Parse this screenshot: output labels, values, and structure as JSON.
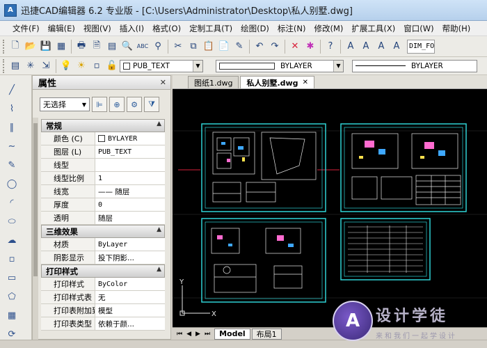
{
  "window": {
    "app_icon": "A",
    "title": "迅捷CAD编辑器 6.2 专业版  - [C:\\Users\\Administrator\\Desktop\\私人别墅.dwg]"
  },
  "menu": [
    "文件(F)",
    "编辑(E)",
    "视图(V)",
    "插入(I)",
    "格式(O)",
    "定制工具(T)",
    "绘图(D)",
    "标注(N)",
    "修改(M)",
    "扩展工具(X)",
    "窗口(W)",
    "帮助(H)"
  ],
  "toolbar1": {
    "icons": [
      "new-file-icon",
      "open-file-icon",
      "save-icon",
      "save-all-icon",
      "print-icon",
      "print-preview-icon",
      "plot-icon",
      "find-icon",
      "spell-check-icon",
      "binoculars-icon",
      "cut-icon",
      "copy-icon",
      "paste-icon",
      "paste-special-icon",
      "match-prop-icon",
      "undo-icon",
      "redo-icon",
      "delete-icon",
      "explode-icon",
      "help-icon",
      "text-a-icon",
      "text-a2-icon",
      "text-edit-icon",
      "text-style-icon"
    ],
    "glyphs": [
      "🗋",
      "📂",
      "💾",
      "▦",
      "🖶",
      "🗎",
      "▤",
      "🔍",
      "ABC",
      "⚲",
      "✂",
      "⧉",
      "📋",
      "📄",
      "✎",
      "↶",
      "↷",
      "✕",
      "✱",
      "?",
      "A",
      "A",
      "A",
      "A"
    ],
    "dim_font": "DIM_FO"
  },
  "toolbar2": {
    "layer": "PUB_TEXT",
    "color": "BYLAYER",
    "linetype": "BYLAYER"
  },
  "left_tools": [
    {
      "name": "line-icon",
      "glyph": "╱"
    },
    {
      "name": "polyline-icon",
      "glyph": "⌇"
    },
    {
      "name": "double-line-icon",
      "glyph": "∥"
    },
    {
      "name": "spline-icon",
      "glyph": "∼"
    },
    {
      "name": "freehand-icon",
      "glyph": "✎"
    },
    {
      "name": "circle-icon",
      "glyph": "◯"
    },
    {
      "name": "arc-icon",
      "glyph": "◜"
    },
    {
      "name": "ellipse-icon",
      "glyph": "⬭"
    },
    {
      "name": "cloud-icon",
      "glyph": "☁"
    },
    {
      "name": "point-icon",
      "glyph": "▫"
    },
    {
      "name": "rectangle-icon",
      "glyph": "▭"
    },
    {
      "name": "polygon-icon",
      "glyph": "⬠"
    },
    {
      "name": "hatch-icon",
      "glyph": "▦"
    },
    {
      "name": "regen-icon",
      "glyph": "⟳"
    }
  ],
  "properties": {
    "title": "属性",
    "close": "✕",
    "selection": "无选择",
    "sections": [
      {
        "title": "常规",
        "rows": [
          {
            "key": "颜色 (C)",
            "value": "BYLAYER",
            "swatch": true
          },
          {
            "key": "图层 (L)",
            "value": "PUB_TEXT"
          },
          {
            "key": "线型",
            "value": ""
          },
          {
            "key": "线型比例",
            "value": "1"
          },
          {
            "key": "线宽",
            "value": "—— 随层"
          },
          {
            "key": "厚度",
            "value": "0"
          },
          {
            "key": "透明",
            "value": "随层"
          }
        ]
      },
      {
        "title": "三维效果",
        "rows": [
          {
            "key": "材质",
            "value": "ByLayer"
          },
          {
            "key": "阴影显示",
            "value": "投下阴影..."
          }
        ]
      },
      {
        "title": "打印样式",
        "rows": [
          {
            "key": "打印样式",
            "value": "ByColor"
          },
          {
            "key": "打印样式表",
            "value": "无"
          },
          {
            "key": "打印表附加到",
            "value": "模型"
          },
          {
            "key": "打印表类型",
            "value": "依赖于颜..."
          }
        ]
      }
    ]
  },
  "doc_tabs": [
    {
      "label": "图纸1.dwg",
      "active": false
    },
    {
      "label": "私人别墅.dwg",
      "active": true
    }
  ],
  "layout_tabs": [
    {
      "label": "Model",
      "active": true
    },
    {
      "label": "布局1",
      "active": false
    }
  ],
  "watermark": {
    "logo": "A",
    "title": "设计学徒",
    "subtitle": "来和我们一起学设计"
  },
  "colors": {
    "canvas_bg": "#000000",
    "frame": "#2fd3d6",
    "drawing": "#e8e8e8",
    "accent_red": "#d8203a"
  }
}
